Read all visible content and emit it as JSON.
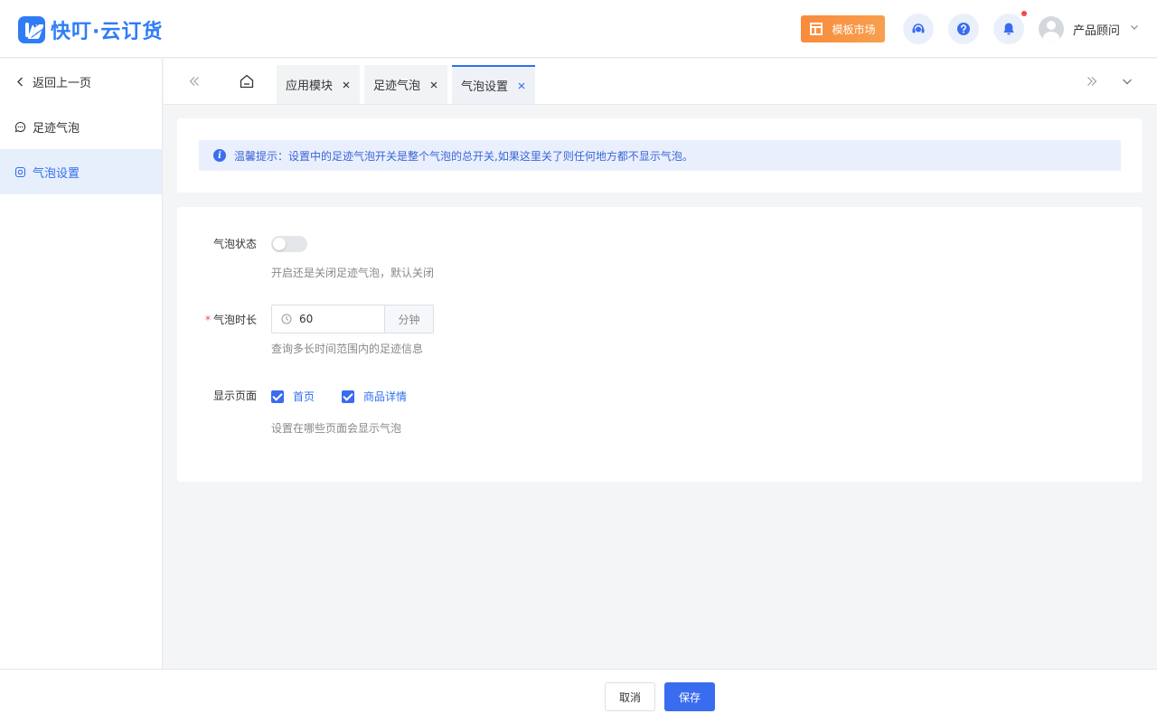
{
  "header": {
    "logo_text": "快叮·云订货",
    "template_market": "模板市场",
    "user_name": "产品顾问",
    "icons": [
      "customer-service-icon",
      "help-icon",
      "bell-icon"
    ]
  },
  "sidebar": {
    "items": [
      {
        "label": "返回上一页",
        "icon": "chevron-left-icon"
      },
      {
        "label": "足迹气泡",
        "icon": "chat-bubble-icon"
      },
      {
        "label": "气泡设置",
        "icon": "settings-icon",
        "active": true
      }
    ]
  },
  "tabs": {
    "items": [
      {
        "label": "应用模块"
      },
      {
        "label": "足迹气泡"
      },
      {
        "label": "气泡设置",
        "active": true
      }
    ]
  },
  "notice": {
    "text": "温馨提示：设置中的足迹气泡开关是整个气泡的总开关,如果这里关了则任何地方都不显示气泡。"
  },
  "form": {
    "status_label": "气泡状态",
    "status_on": false,
    "status_hint": "开启还是关闭足迹气泡，默认关闭",
    "duration_label": "气泡时长",
    "duration_value": "60",
    "duration_unit": "分钟",
    "duration_hint": "查询多长时间范围内的足迹信息",
    "pages_label": "显示页面",
    "pages": [
      {
        "label": "首页",
        "checked": true
      },
      {
        "label": "商品详情",
        "checked": true
      }
    ],
    "pages_hint": "设置在哪些页面会显示气泡"
  },
  "footer": {
    "cancel_label": "取消",
    "save_label": "保存"
  },
  "colors": {
    "accent": "#3a6cf0",
    "brand": "#2f7cf6",
    "template_btn": "#f98b3c",
    "notice_bg": "#e9effd"
  }
}
